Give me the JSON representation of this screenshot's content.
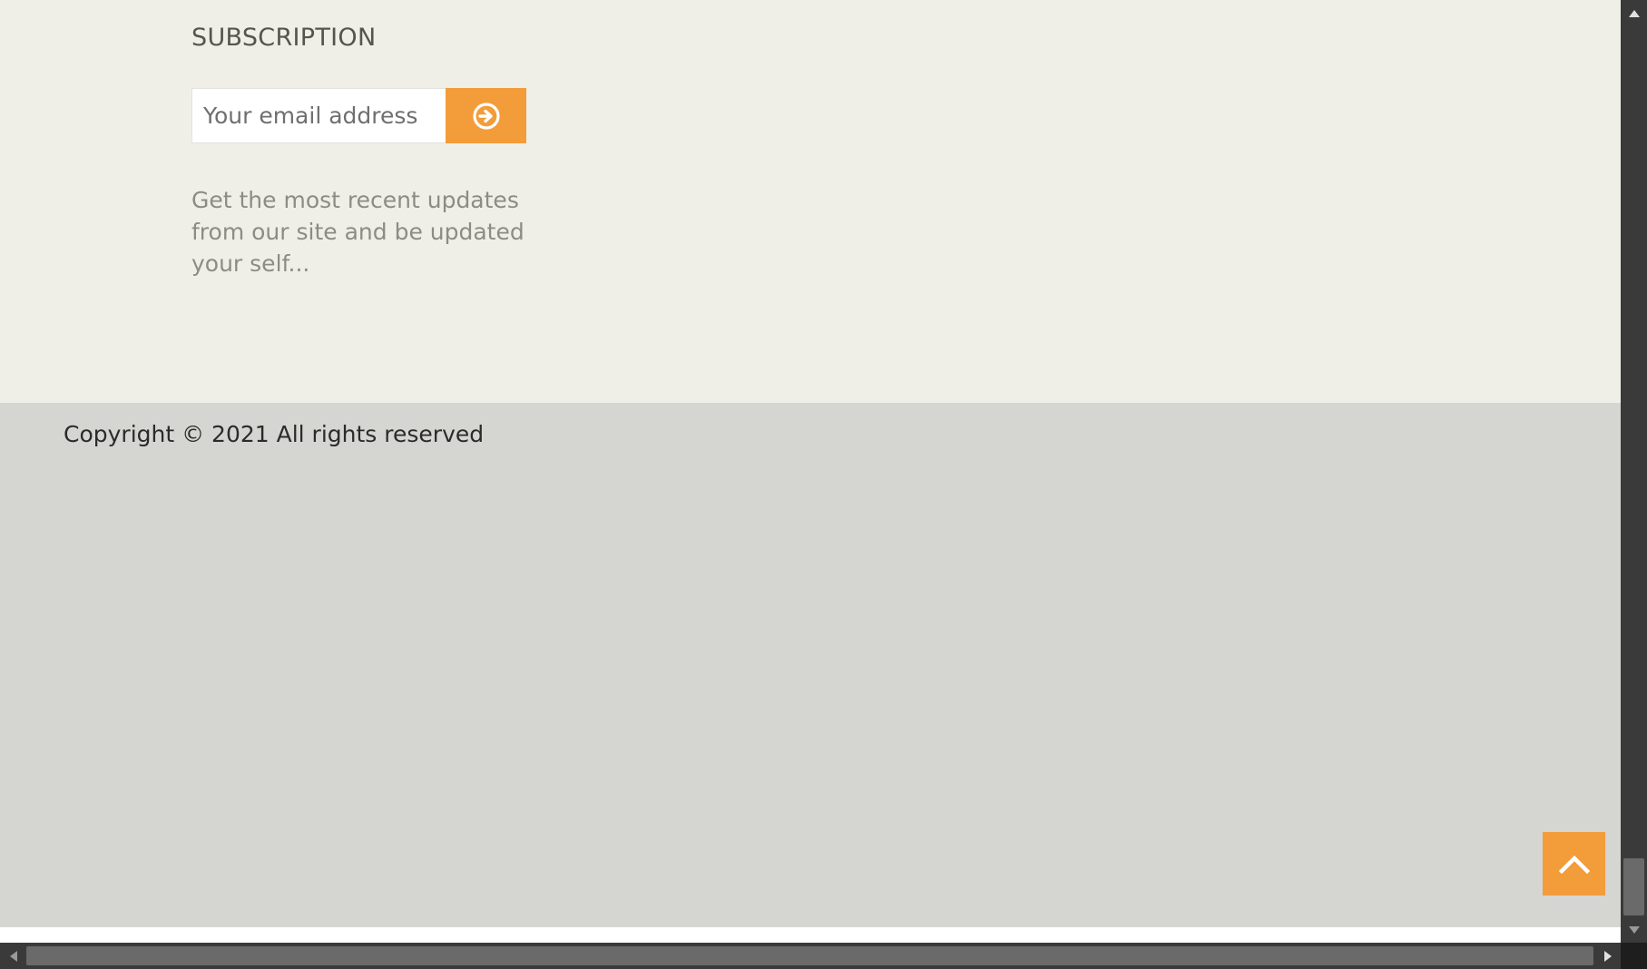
{
  "subscription": {
    "title": "SUBSCRIPTION",
    "email_placeholder": "Your email address",
    "submit_icon": "arrow-circle-right-icon",
    "description": "Get the most recent updates from our site and be updated your self..."
  },
  "footer": {
    "copyright": "Copyright © 2021 All rights reserved"
  },
  "back_to_top": {
    "icon": "chevron-up-icon"
  },
  "colors": {
    "accent": "#f39c3a",
    "subscription_bg": "#efefe8",
    "footer_bg": "#d5d6d1"
  }
}
